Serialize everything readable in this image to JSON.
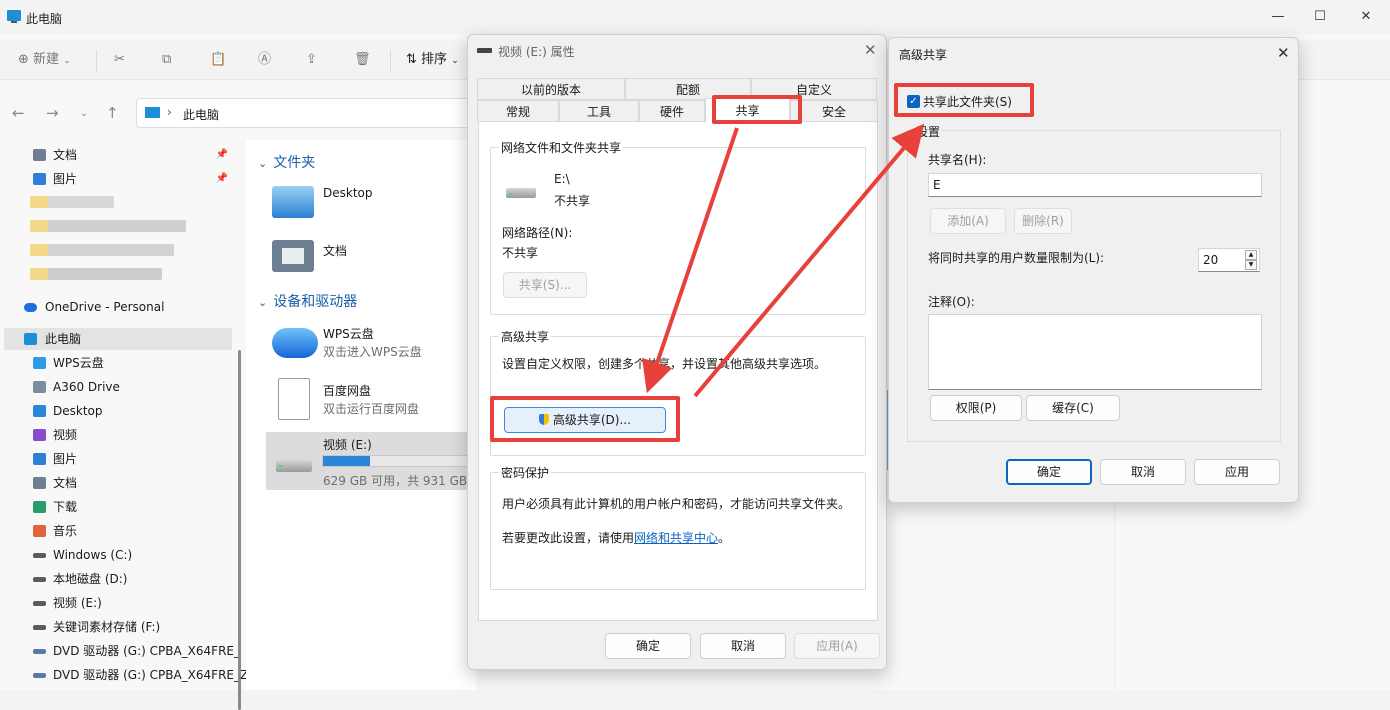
{
  "explorer": {
    "title": "此电脑",
    "toolbar": {
      "new_label": "新建",
      "sort_label": "排序"
    },
    "address": {
      "crumb": "此电脑"
    },
    "sidebar": {
      "quick": [
        {
          "label": "文档",
          "icon": "document-icon"
        },
        {
          "label": "图片",
          "icon": "picture-icon"
        }
      ],
      "onedrive": "OneDrive - Personal",
      "this_pc": "此电脑",
      "pc_items": [
        {
          "label": "WPS云盘",
          "icon": "cloud-icon"
        },
        {
          "label": "A360 Drive",
          "icon": "a360-icon"
        },
        {
          "label": "Desktop",
          "icon": "desktop-icon"
        },
        {
          "label": "视频",
          "icon": "video-icon"
        },
        {
          "label": "图片",
          "icon": "picture-icon"
        },
        {
          "label": "文档",
          "icon": "document-icon"
        },
        {
          "label": "下载",
          "icon": "download-icon"
        },
        {
          "label": "音乐",
          "icon": "music-icon"
        },
        {
          "label": "Windows (C:)",
          "icon": "drive-icon"
        },
        {
          "label": "本地磁盘 (D:)",
          "icon": "drive-icon"
        },
        {
          "label": "视频 (E:)",
          "icon": "drive-icon"
        },
        {
          "label": "关键词素材存储 (F:)",
          "icon": "drive-icon"
        },
        {
          "label": "DVD 驱动器 (G:) CPBA_X64FRE_",
          "icon": "dvd-icon"
        },
        {
          "label": "DVD 驱动器 (G:) CPBA_X64FRE_Z",
          "icon": "dvd-icon"
        }
      ]
    },
    "content": {
      "folders_header": "文件夹",
      "folders": [
        {
          "name": "Desktop"
        },
        {
          "name": "文档"
        }
      ],
      "devices_header": "设备和驱动器",
      "devices": [
        {
          "name": "WPS云盘",
          "sub": "双击进入WPS云盘"
        },
        {
          "name": "百度网盘",
          "sub": "双击运行百度网盘"
        },
        {
          "name": "视频 (E:)",
          "sub": "629 GB 可用，共 931 GB",
          "used_fraction": 0.32
        }
      ]
    }
  },
  "props": {
    "title": "视频 (E:) 属性",
    "tabs_row1": [
      "以前的版本",
      "配额",
      "自定义"
    ],
    "tabs_row2": [
      "常规",
      "工具",
      "硬件",
      "共享",
      "安全"
    ],
    "active_tab": "共享",
    "network_share": {
      "group_title": "网络文件和文件夹共享",
      "path": "E:\\",
      "status": "不共享",
      "network_path_label": "网络路径(N):",
      "network_path_value": "不共享",
      "share_button": "共享(S)..."
    },
    "advanced": {
      "group_title": "高级共享",
      "description": "设置自定义权限，创建多个共享，并设置其他高级共享选项。",
      "button": "高级共享(D)..."
    },
    "password": {
      "group_title": "密码保护",
      "line1": "用户必须具有此计算机的用户帐户和密码，才能访问共享文件夹。",
      "line2_prefix": "若要更改此设置，请使用",
      "link": "网络和共享中心",
      "line2_suffix": "。"
    },
    "buttons": {
      "ok": "确定",
      "cancel": "取消",
      "apply": "应用(A)"
    }
  },
  "adv": {
    "title": "高级共享",
    "share_checkbox": "共享此文件夹(S)",
    "share_checked": true,
    "settings_title": "设置",
    "share_name_label": "共享名(H):",
    "share_name_value": "E",
    "add_button": "添加(A)",
    "remove_button": "删除(R)",
    "limit_label": "将同时共享的用户数量限制为(L):",
    "limit_value": "20",
    "comment_label": "注释(O):",
    "comment_value": "",
    "permissions_button": "权限(P)",
    "caching_button": "缓存(C)",
    "buttons": {
      "ok": "确定",
      "cancel": "取消",
      "apply": "应用"
    }
  },
  "colors": {
    "highlight": "#e8403a",
    "accent": "#0a64c0",
    "link": "#0a64c0"
  }
}
